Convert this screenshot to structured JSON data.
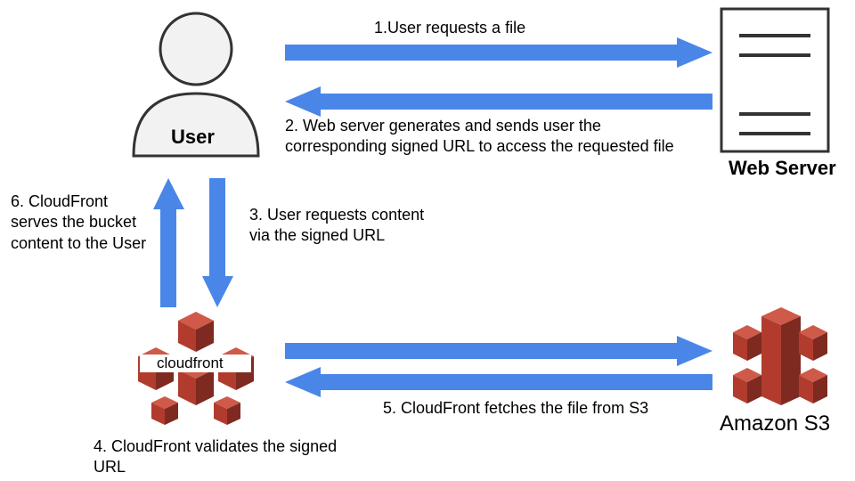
{
  "colors": {
    "arrow": "#4a86e8",
    "aws_red": "#b13c2e",
    "aws_red_dark": "#7e2a20",
    "aws_red_light": "#cf5a49",
    "line": "#333333"
  },
  "nodes": {
    "user": {
      "label": "User"
    },
    "webserver": {
      "label": "Web Server"
    },
    "cloudfront": {
      "label": "cloudfront"
    },
    "s3": {
      "label": "Amazon S3"
    }
  },
  "steps": {
    "s1": "1.User requests a file",
    "s2": "2. Web server generates and sends user the corresponding signed URL to access the requested file",
    "s3": "3. User requests content via the signed URL",
    "s4": "4. CloudFront validates the signed URL",
    "s5": "5. CloudFront fetches the file from S3",
    "s6": "6. CloudFront serves the bucket content to the User"
  }
}
